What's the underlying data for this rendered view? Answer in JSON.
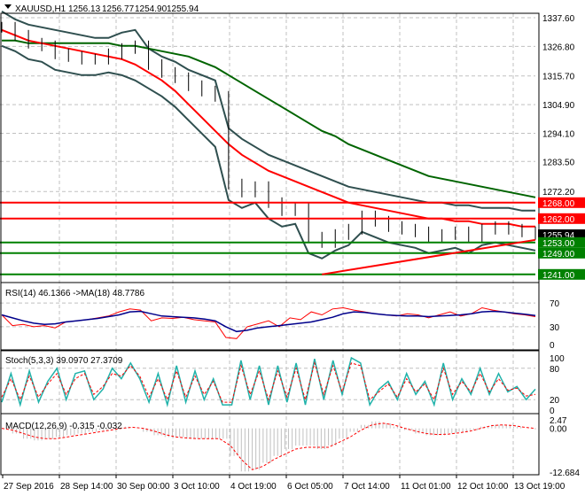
{
  "header": {
    "symbol": "XAUUSD,H1",
    "open": "1256.13",
    "high": "1256.77",
    "low": "1254.90",
    "close": "1255.94"
  },
  "colors": {
    "ma_fast": "#ff0000",
    "ma_slow": "#006400",
    "bands": "#2f4f4f",
    "rsi": "#ff0000",
    "rsi_ma": "#00008b",
    "stoch_main": "#20b2aa",
    "stoch_signal": "#ff0000",
    "macd_hist": "#c0c0c0",
    "macd_signal": "#ff0000",
    "support": "#008000",
    "resistance": "#ff0000"
  },
  "chart_data": [
    {
      "type": "line",
      "title": "XAUUSD,H1 1256.13 1256.77 1254.90 1255.94",
      "x_labels": [
        "27 Sep 2016",
        "28 Sep 14:00",
        "30 Sep 00:00",
        "3 Oct 10:00",
        "4 Oct 19:00",
        "6 Oct 05:00",
        "7 Oct 14:00",
        "11 Oct 01:00",
        "12 Oct 10:00",
        "13 Oct 19:00"
      ],
      "y_ticks": [
        "1337.60",
        "1326.80",
        "1315.70",
        "1304.90",
        "1294.10",
        "1283.50",
        "1272.20"
      ],
      "ylim": [
        1238,
        1343
      ],
      "close": [
        1334,
        1331,
        1328,
        1327,
        1324,
        1323,
        1322,
        1322,
        1324,
        1326,
        1327,
        1320,
        1317,
        1315,
        1312,
        1310,
        1308,
        1275,
        1272,
        1274,
        1268,
        1265,
        1266,
        1255,
        1253,
        1256,
        1258,
        1263,
        1261,
        1259,
        1258,
        1257,
        1255,
        1256,
        1257,
        1255,
        1258,
        1259,
        1258,
        1257,
        1256
      ],
      "ma_fast": [
        1333,
        1331,
        1329,
        1328,
        1327,
        1326,
        1325,
        1324,
        1323,
        1322,
        1320,
        1317,
        1314,
        1310,
        1305,
        1300,
        1295,
        1290,
        1286,
        1283,
        1280,
        1278,
        1276,
        1274,
        1272,
        1270,
        1268,
        1267,
        1266,
        1265,
        1264,
        1263,
        1262,
        1262,
        1261,
        1261,
        1260,
        1260,
        1260,
        1259,
        1259
      ],
      "ma_slow": [
        1329,
        1329,
        1328,
        1328,
        1328,
        1328,
        1328,
        1328,
        1328,
        1327,
        1327,
        1326,
        1325,
        1324,
        1323,
        1321,
        1319,
        1316,
        1313,
        1310,
        1307,
        1304,
        1301,
        1298,
        1295,
        1293,
        1290,
        1288,
        1286,
        1284,
        1282,
        1280,
        1278,
        1277,
        1276,
        1275,
        1274,
        1273,
        1272,
        1271,
        1270
      ],
      "price_labels": [
        {
          "text": "1268.00",
          "value": 1268,
          "kind": "resistance"
        },
        {
          "text": "1262.00",
          "value": 1262,
          "kind": "resistance"
        },
        {
          "text": "1255.94",
          "value": 1255.94,
          "kind": "current"
        },
        {
          "text": "1253.00",
          "value": 1253,
          "kind": "support"
        },
        {
          "text": "1249.00",
          "value": 1249,
          "kind": "support"
        },
        {
          "text": "1241.00",
          "value": 1241,
          "kind": "support"
        }
      ],
      "trendline": {
        "from": [
          24,
          1241
        ],
        "to": [
          40,
          1254
        ]
      }
    },
    {
      "type": "line",
      "title": "RSI(14) 46.1366  ->MA(18) 48.7786",
      "label": "RSI(14) 46.1366  ->MA(18) 48.7786",
      "y_ticks": [
        "70",
        "30",
        "0"
      ],
      "ylim": [
        0,
        100
      ],
      "rsi": [
        50,
        32,
        34,
        30,
        32,
        28,
        38,
        40,
        42,
        45,
        48,
        55,
        60,
        58,
        40,
        45,
        44,
        46,
        42,
        40,
        38,
        12,
        10,
        30,
        35,
        40,
        30,
        45,
        42,
        55,
        50,
        60,
        62,
        58,
        55,
        52,
        50,
        48,
        52,
        50,
        45,
        50,
        55,
        48,
        52,
        62,
        58,
        55,
        52,
        50,
        47
      ],
      "rsi_ma": [
        50,
        45,
        40,
        36,
        34,
        35,
        38,
        40,
        42,
        44,
        47,
        50,
        55,
        56,
        52,
        48,
        47,
        46,
        45,
        43,
        40,
        30,
        22,
        24,
        28,
        30,
        32,
        34,
        36,
        38,
        42,
        46,
        52,
        55,
        54,
        52,
        50,
        49,
        48,
        48,
        47,
        48,
        49,
        50,
        52,
        55,
        56,
        55,
        53,
        51,
        49
      ]
    },
    {
      "type": "line",
      "title": "Stoch(5,3,3) 39.0970 27.3709",
      "label": "Stoch(5,3,3) 39.0970 27.3709",
      "y_ticks": [
        "100",
        "80",
        "20",
        "0"
      ],
      "ylim": [
        0,
        100
      ],
      "main": [
        15,
        70,
        10,
        75,
        15,
        55,
        80,
        20,
        70,
        75,
        20,
        40,
        80,
        60,
        90,
        60,
        15,
        70,
        10,
        85,
        15,
        75,
        20,
        60,
        10,
        10,
        95,
        20,
        85,
        10,
        85,
        15,
        90,
        10,
        98,
        20,
        95,
        30,
        100,
        90,
        10,
        40,
        55,
        20,
        70,
        30,
        55,
        10,
        90,
        20,
        60,
        30,
        80,
        30,
        70,
        35,
        45,
        20,
        40
      ],
      "signal": [
        25,
        60,
        20,
        65,
        25,
        50,
        70,
        30,
        60,
        70,
        30,
        45,
        70,
        65,
        85,
        65,
        25,
        60,
        20,
        75,
        25,
        65,
        30,
        55,
        15,
        15,
        85,
        30,
        75,
        20,
        75,
        25,
        80,
        20,
        90,
        30,
        85,
        35,
        90,
        85,
        20,
        35,
        50,
        25,
        60,
        35,
        50,
        20,
        80,
        30,
        55,
        35,
        70,
        35,
        60,
        38,
        42,
        27,
        30
      ]
    },
    {
      "type": "bar",
      "title": "MACD(12,26,9) -0.315 -0.032",
      "label": "MACD(12,26,9) -0.315 -0.032",
      "y_ticks": [
        "2.47",
        "0.00",
        "-12.684"
      ],
      "ylim": [
        -12.684,
        2.47
      ],
      "histogram": [
        0,
        -1.5,
        -3,
        -3.5,
        -3,
        -2.5,
        -2,
        -1.5,
        -1,
        -0.5,
        0,
        0.5,
        0,
        -1,
        -2,
        -2.5,
        -2.5,
        -3,
        -3,
        -3,
        -3,
        -8,
        -12.5,
        -12,
        -10,
        -8,
        -6,
        -5,
        -5,
        -6,
        -5,
        -3,
        -1,
        1,
        2,
        1.5,
        0.5,
        -0.5,
        -1.5,
        -2,
        -2,
        -1.5,
        -1,
        -0.5,
        0.5,
        1,
        1,
        0.5,
        0,
        -0.3
      ],
      "signal": [
        0,
        -0.5,
        -1.5,
        -2.5,
        -3,
        -3,
        -2.5,
        -2,
        -1.5,
        -1,
        -0.5,
        0,
        0.3,
        0,
        -0.8,
        -1.8,
        -2.5,
        -2.8,
        -3,
        -3,
        -3,
        -5,
        -9,
        -12,
        -11,
        -9,
        -7.5,
        -6,
        -5.5,
        -5.5,
        -5.5,
        -4,
        -2.5,
        -0.5,
        1,
        1.5,
        1,
        0,
        -0.8,
        -1.5,
        -1.8,
        -1.7,
        -1.3,
        -0.8,
        0,
        0.8,
        1,
        0.8,
        0.3,
        -0.03
      ]
    }
  ]
}
